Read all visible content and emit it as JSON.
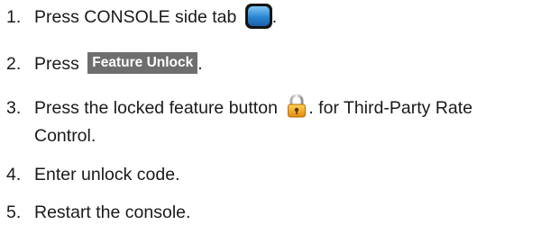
{
  "steps": [
    {
      "number": "1.",
      "text_before": "Press CONSOLE side tab",
      "icon": "console-side-tab-icon",
      "text_after": "."
    },
    {
      "number": "2.",
      "text_before": "Press",
      "button_label": "Feature Unlock",
      "text_after": "."
    },
    {
      "number": "3.",
      "text_before": "Press the locked feature button",
      "icon": "padlock-icon",
      "text_after": ". for Third-Party Rate",
      "text_line2": "Control."
    },
    {
      "number": "4.",
      "text": "Enter unlock code."
    },
    {
      "number": "5.",
      "text": "Restart the console."
    }
  ],
  "colors": {
    "text": "#1a1a1a",
    "button_bg": "#6e6e6e",
    "button_text": "#ffffff",
    "console_icon_blue": "#2a86d2",
    "lock_body": "#f2a51a"
  }
}
